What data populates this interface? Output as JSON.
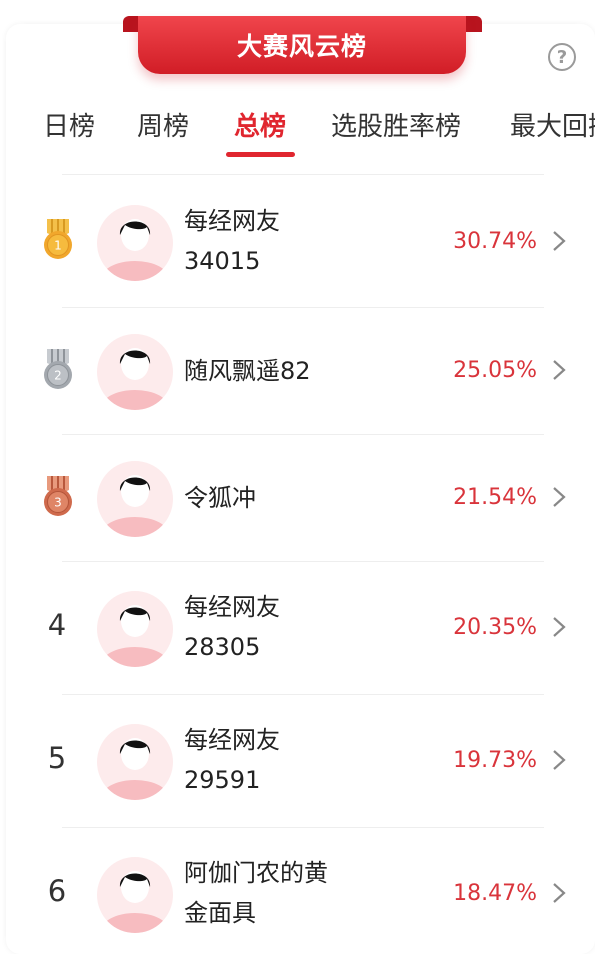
{
  "header": {
    "title": "大赛风云榜",
    "help_icon": "?"
  },
  "tabs": [
    {
      "label": "日榜",
      "active": false
    },
    {
      "label": "周榜",
      "active": false
    },
    {
      "label": "总榜",
      "active": true
    },
    {
      "label": "选股胜率榜",
      "active": false
    },
    {
      "label": "最大回撤",
      "active": false
    }
  ],
  "colors": {
    "accent": "#e0262f",
    "percent": "#d9343b",
    "gold": "#f2b134",
    "silver": "#aeb2b8",
    "bronze": "#d9785a"
  },
  "rows": [
    {
      "rank": "1",
      "medal": "gold",
      "name_line1": "每经网友",
      "name_line2": "34015",
      "return": "30.74%"
    },
    {
      "rank": "2",
      "medal": "silver",
      "name_line1": "随风飘遥82",
      "name_line2": "",
      "return": "25.05%"
    },
    {
      "rank": "3",
      "medal": "bronze",
      "name_line1": "令狐冲",
      "name_line2": "",
      "return": "21.54%"
    },
    {
      "rank": "4",
      "medal": "",
      "name_line1": "每经网友",
      "name_line2": "28305",
      "return": "20.35%"
    },
    {
      "rank": "5",
      "medal": "",
      "name_line1": "每经网友",
      "name_line2": "29591",
      "return": "19.73%"
    },
    {
      "rank": "6",
      "medal": "",
      "name_line1": "阿伽门农的黄",
      "name_line2": "金面具",
      "return": "18.47%"
    }
  ]
}
